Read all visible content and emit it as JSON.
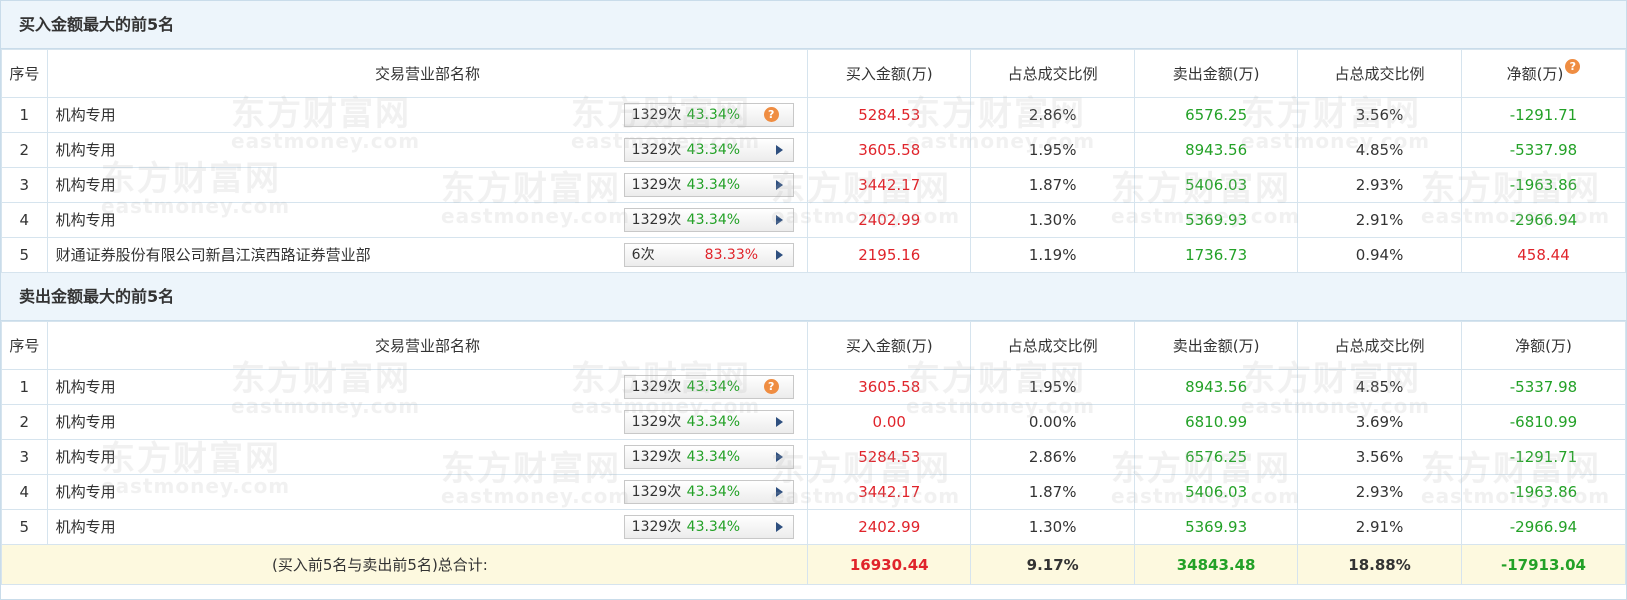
{
  "buy_section": {
    "title": "买入金额最大的前5名",
    "headers": [
      "序号",
      "交易营业部名称",
      "买入金额(万)",
      "占总成交比例",
      "卖出金额(万)",
      "占总成交比例",
      "净额(万)"
    ],
    "rows": [
      {
        "idx": "1",
        "name": "机构专用",
        "count": "1329次",
        "pct": "43.34%",
        "pct_color": "green",
        "icon": "question-icon",
        "buy": "5284.53",
        "buy_ratio": "2.86%",
        "sell": "6576.25",
        "sell_ratio": "3.56%",
        "net": "-1291.71",
        "net_color": "green"
      },
      {
        "idx": "2",
        "name": "机构专用",
        "count": "1329次",
        "pct": "43.34%",
        "pct_color": "green",
        "icon": "arrow-right-icon",
        "buy": "3605.58",
        "buy_ratio": "1.95%",
        "sell": "8943.56",
        "sell_ratio": "4.85%",
        "net": "-5337.98",
        "net_color": "green"
      },
      {
        "idx": "3",
        "name": "机构专用",
        "count": "1329次",
        "pct": "43.34%",
        "pct_color": "green",
        "icon": "arrow-right-icon",
        "buy": "3442.17",
        "buy_ratio": "1.87%",
        "sell": "5406.03",
        "sell_ratio": "2.93%",
        "net": "-1963.86",
        "net_color": "green"
      },
      {
        "idx": "4",
        "name": "机构专用",
        "count": "1329次",
        "pct": "43.34%",
        "pct_color": "green",
        "icon": "arrow-right-icon",
        "buy": "2402.99",
        "buy_ratio": "1.30%",
        "sell": "5369.93",
        "sell_ratio": "2.91%",
        "net": "-2966.94",
        "net_color": "green"
      },
      {
        "idx": "5",
        "name": "财通证券股份有限公司新昌江滨西路证券营业部",
        "count": "6次",
        "pct": "83.33%",
        "pct_color": "red",
        "icon": "arrow-right-icon",
        "buy": "2195.16",
        "buy_ratio": "1.19%",
        "sell": "1736.73",
        "sell_ratio": "0.94%",
        "net": "458.44",
        "net_color": "red"
      }
    ]
  },
  "sell_section": {
    "title": "卖出金额最大的前5名",
    "headers": [
      "序号",
      "交易营业部名称",
      "买入金额(万)",
      "占总成交比例",
      "卖出金额(万)",
      "占总成交比例",
      "净额(万)"
    ],
    "rows": [
      {
        "idx": "1",
        "name": "机构专用",
        "count": "1329次",
        "pct": "43.34%",
        "pct_color": "green",
        "icon": "question-icon",
        "buy": "3605.58",
        "buy_ratio": "1.95%",
        "sell": "8943.56",
        "sell_ratio": "4.85%",
        "net": "-5337.98",
        "net_color": "green"
      },
      {
        "idx": "2",
        "name": "机构专用",
        "count": "1329次",
        "pct": "43.34%",
        "pct_color": "green",
        "icon": "arrow-right-icon",
        "buy": "0.00",
        "buy_ratio": "0.00%",
        "sell": "6810.99",
        "sell_ratio": "3.69%",
        "net": "-6810.99",
        "net_color": "green"
      },
      {
        "idx": "3",
        "name": "机构专用",
        "count": "1329次",
        "pct": "43.34%",
        "pct_color": "green",
        "icon": "arrow-right-icon",
        "buy": "5284.53",
        "buy_ratio": "2.86%",
        "sell": "6576.25",
        "sell_ratio": "3.56%",
        "net": "-1291.71",
        "net_color": "green"
      },
      {
        "idx": "4",
        "name": "机构专用",
        "count": "1329次",
        "pct": "43.34%",
        "pct_color": "green",
        "icon": "arrow-right-icon",
        "buy": "3442.17",
        "buy_ratio": "1.87%",
        "sell": "5406.03",
        "sell_ratio": "2.93%",
        "net": "-1963.86",
        "net_color": "green"
      },
      {
        "idx": "5",
        "name": "机构专用",
        "count": "1329次",
        "pct": "43.34%",
        "pct_color": "green",
        "icon": "arrow-right-icon",
        "buy": "2402.99",
        "buy_ratio": "1.30%",
        "sell": "5369.93",
        "sell_ratio": "2.91%",
        "net": "-2966.94",
        "net_color": "green"
      }
    ]
  },
  "total": {
    "label": "(买入前5名与卖出前5名)总合计:",
    "buy": "16930.44",
    "buy_ratio": "9.17%",
    "sell": "34843.48",
    "sell_ratio": "18.88%",
    "net": "-17913.04",
    "buy_color": "red",
    "sell_color": "green",
    "net_color": "green"
  },
  "icons": {
    "question": "?"
  },
  "watermark": {
    "cn": "东方财富网",
    "en": "eastmoney.com"
  },
  "colors": {
    "red": "#e0242b",
    "green": "#23a127",
    "header_bg": "#edf5fb",
    "total_bg": "#fdf9df",
    "orange_icon": "#ef8d42"
  }
}
